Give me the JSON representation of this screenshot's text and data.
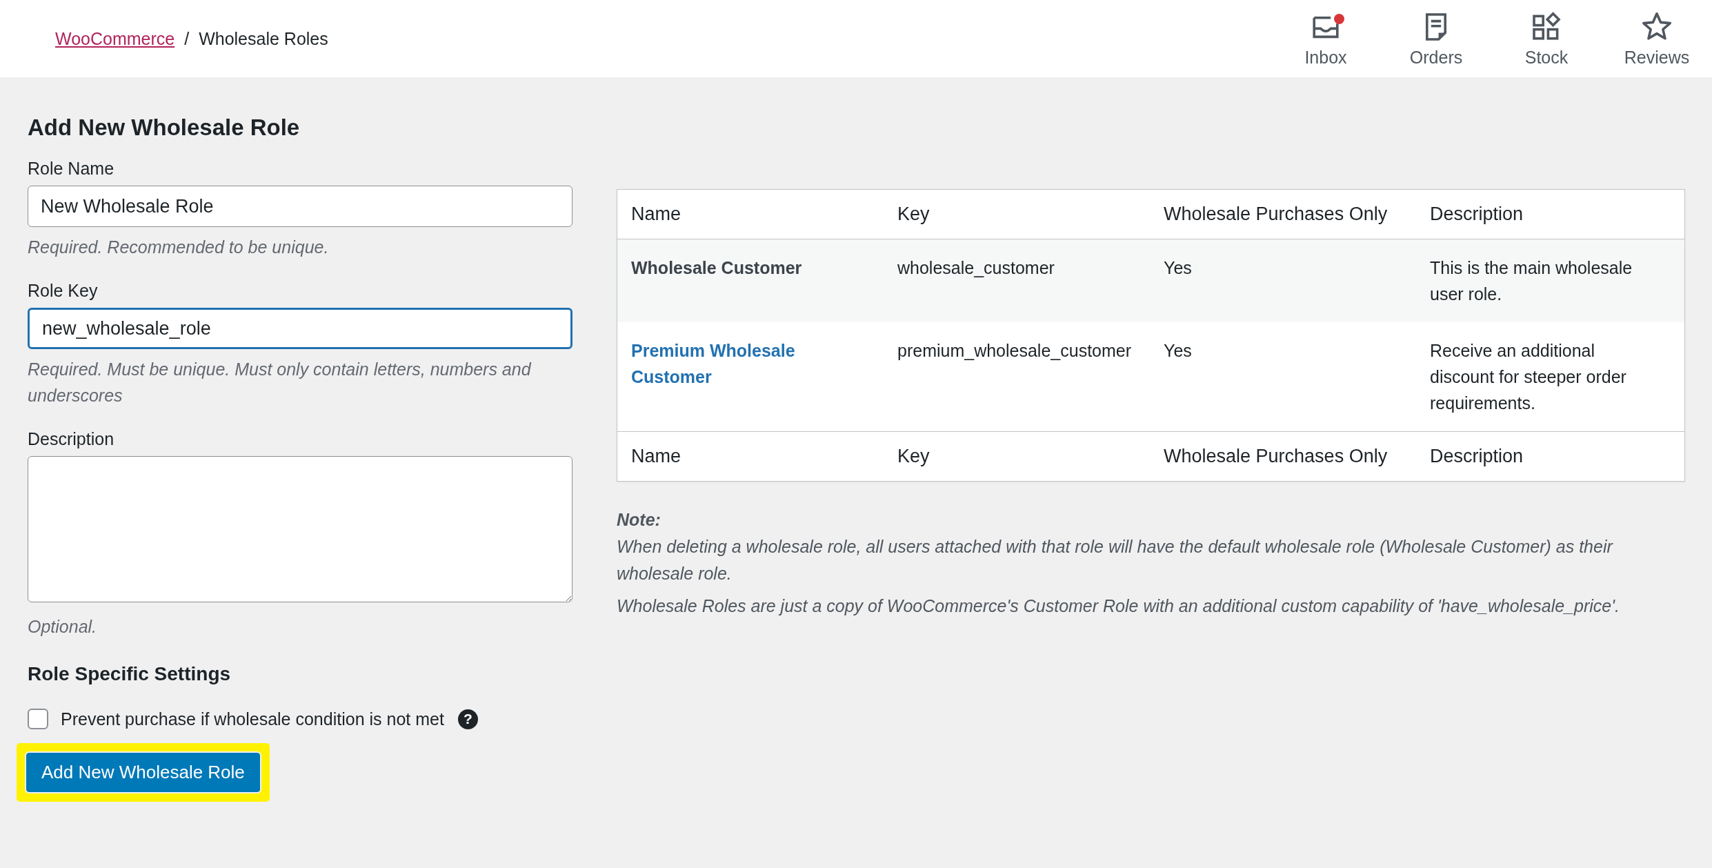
{
  "breadcrumb": {
    "link": "WooCommerce",
    "separator": "/",
    "current": "Wholesale Roles"
  },
  "header_actions": [
    {
      "label": "Inbox",
      "kind": "inbox",
      "badge": true
    },
    {
      "label": "Orders",
      "kind": "orders",
      "badge": false
    },
    {
      "label": "Stock",
      "kind": "stock",
      "badge": false
    },
    {
      "label": "Reviews",
      "kind": "reviews",
      "badge": false
    }
  ],
  "form": {
    "title": "Add New Wholesale Role",
    "fields": [
      {
        "label": "Role Name",
        "kind": "input",
        "value": "New Wholesale Role",
        "focused": false,
        "hint": "Required. Recommended to be unique."
      },
      {
        "label": "Role Key",
        "kind": "input",
        "value": "new_wholesale_role",
        "focused": true,
        "hint": "Required. Must be unique. Must only contain letters, numbers and underscores"
      },
      {
        "label": "Description",
        "kind": "textarea",
        "focused": false,
        "hint": "Optional."
      }
    ],
    "settings_title": "Role Specific Settings",
    "checkbox": {
      "label": "Prevent purchase if wholesale condition is not met",
      "checked": false,
      "help": "?"
    },
    "submit": {
      "label": "Add New Wholesale Role",
      "highlighted": true
    }
  },
  "table": {
    "columns": [
      "Name",
      "Key",
      "Wholesale Purchases Only",
      "Description"
    ],
    "rows": [
      {
        "name": "Wholesale Customer",
        "kind": "text",
        "key": "wholesale_customer",
        "wholesale_only": "Yes",
        "description": "This is the main wholesale user role."
      },
      {
        "name": "Premium Wholesale Customer",
        "kind": "link",
        "key": "premium_wholesale_customer",
        "wholesale_only": "Yes",
        "description": "Receive an additional discount for steeper order requirements."
      }
    ],
    "footer_columns": [
      "Name",
      "Key",
      "Wholesale Purchases Only",
      "Description"
    ]
  },
  "note": {
    "title": "Note:",
    "paragraphs": [
      "When deleting a wholesale role, all users attached with that role will have the default wholesale role (Wholesale Customer) as their wholesale role.",
      "Wholesale Roles are just a copy of WooCommerce's Customer Role with an additional custom capability of 'have_wholesale_price'."
    ]
  }
}
